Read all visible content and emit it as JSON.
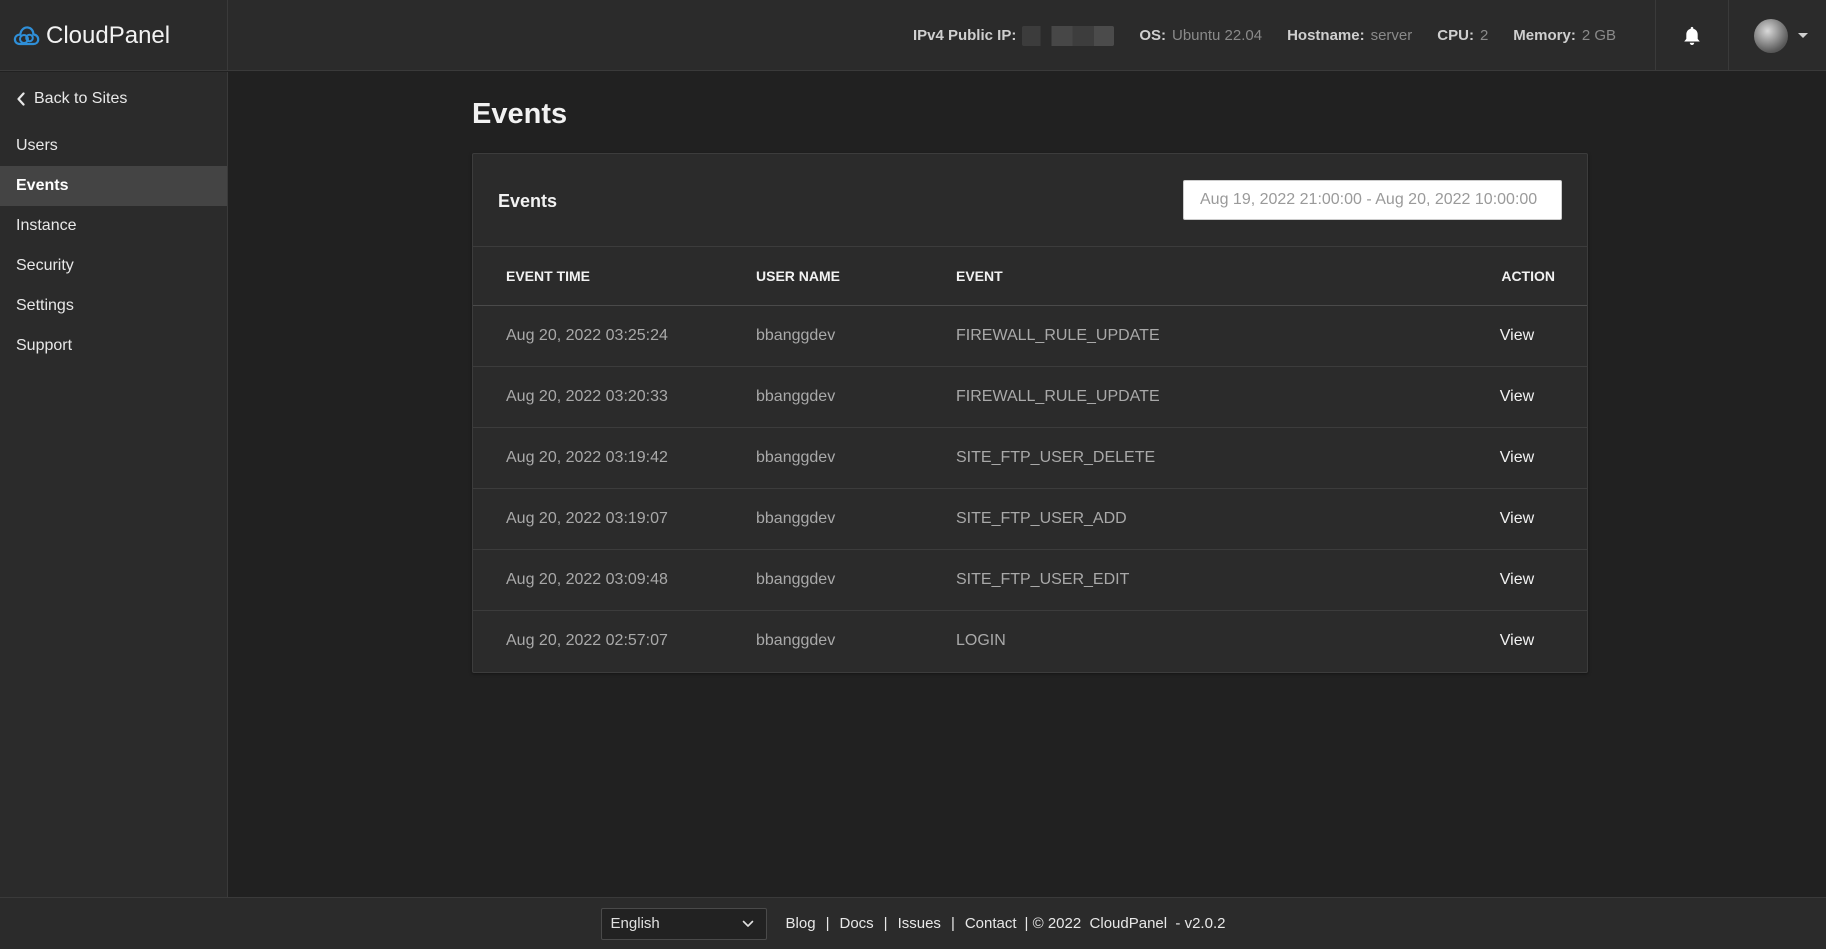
{
  "brand": {
    "name": "CloudPanel"
  },
  "sysinfo": [
    {
      "label": "IPv4 Public IP:",
      "value": ""
    },
    {
      "label": "OS:",
      "value": "Ubuntu 22.04"
    },
    {
      "label": "Hostname:",
      "value": "server"
    },
    {
      "label": "CPU:",
      "value": "2"
    },
    {
      "label": "Memory:",
      "value": "2 GB"
    }
  ],
  "sidebar": {
    "back_label": "Back to Sites",
    "items": [
      {
        "label": "Users"
      },
      {
        "label": "Events"
      },
      {
        "label": "Instance"
      },
      {
        "label": "Security"
      },
      {
        "label": "Settings"
      },
      {
        "label": "Support"
      }
    ]
  },
  "main": {
    "page_title": "Events",
    "card_title": "Events",
    "date_range": {
      "placeholder": "Aug 19, 2022 21:00:00 - Aug 20, 2022 10:00:00"
    },
    "columns": [
      "EVENT TIME",
      "USER NAME",
      "EVENT",
      "ACTION"
    ],
    "rows": [
      {
        "time": "Aug 20, 2022 03:25:24",
        "user": "bbanggdev",
        "event": "FIREWALL_RULE_UPDATE",
        "action": "View"
      },
      {
        "time": "Aug 20, 2022 03:20:33",
        "user": "bbanggdev",
        "event": "FIREWALL_RULE_UPDATE",
        "action": "View"
      },
      {
        "time": "Aug 20, 2022 03:19:42",
        "user": "bbanggdev",
        "event": "SITE_FTP_USER_DELETE",
        "action": "View"
      },
      {
        "time": "Aug 20, 2022 03:19:07",
        "user": "bbanggdev",
        "event": "SITE_FTP_USER_ADD",
        "action": "View"
      },
      {
        "time": "Aug 20, 2022 03:09:48",
        "user": "bbanggdev",
        "event": "SITE_FTP_USER_EDIT",
        "action": "View"
      },
      {
        "time": "Aug 20, 2022 02:57:07",
        "user": "bbanggdev",
        "event": "LOGIN",
        "action": "View"
      }
    ]
  },
  "footer": {
    "language": "English",
    "links": [
      "Blog",
      "Docs",
      "Issues",
      "Contact"
    ],
    "copyright": "| © 2022  CloudPanel  - v2.0.2"
  },
  "colors": {
    "accent": "#2f8fd8",
    "background": "#212121",
    "panel": "#2b2b2b"
  },
  "icons": {
    "logo": "cloud-logo-icon",
    "back": "chevron-left-icon",
    "notifications": "bell-icon",
    "language_dropdown": "chevron-down-icon"
  }
}
